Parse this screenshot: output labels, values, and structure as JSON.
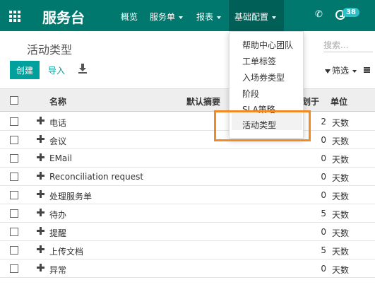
{
  "navbar": {
    "app_title": "服务台",
    "menus": [
      "概览",
      "服务单",
      "报表",
      "基础配置"
    ],
    "badge_count": "38",
    "color": "#00786e"
  },
  "control": {
    "title": "活动类型",
    "search_placeholder": "搜索...",
    "create_label": "创建",
    "import_label": "导入",
    "filter_label": "筛选"
  },
  "table": {
    "headers": {
      "name": "名称",
      "summary": "默认摘要",
      "planned": "划于",
      "unit": "单位"
    },
    "rows": [
      {
        "name": "电话",
        "num": "2",
        "unit": "天数"
      },
      {
        "name": "会议",
        "num": "0",
        "unit": "天数"
      },
      {
        "name": "EMail",
        "num": "0",
        "unit": "天数"
      },
      {
        "name": "Reconciliation request",
        "num": "0",
        "unit": "天数"
      },
      {
        "name": "处理服务单",
        "num": "0",
        "unit": "天数"
      },
      {
        "name": "待办",
        "num": "5",
        "unit": "天数"
      },
      {
        "name": "提醒",
        "num": "0",
        "unit": "天数"
      },
      {
        "name": "上传文档",
        "num": "5",
        "unit": "天数"
      },
      {
        "name": "异常",
        "num": "0",
        "unit": "天数"
      }
    ]
  },
  "dropdown": {
    "items": [
      "帮助中心团队",
      "工单标签",
      "入场券类型",
      "阶段",
      "SLA策略",
      "活动类型"
    ],
    "active_index": 5
  },
  "highlight_color": "#f08a24"
}
